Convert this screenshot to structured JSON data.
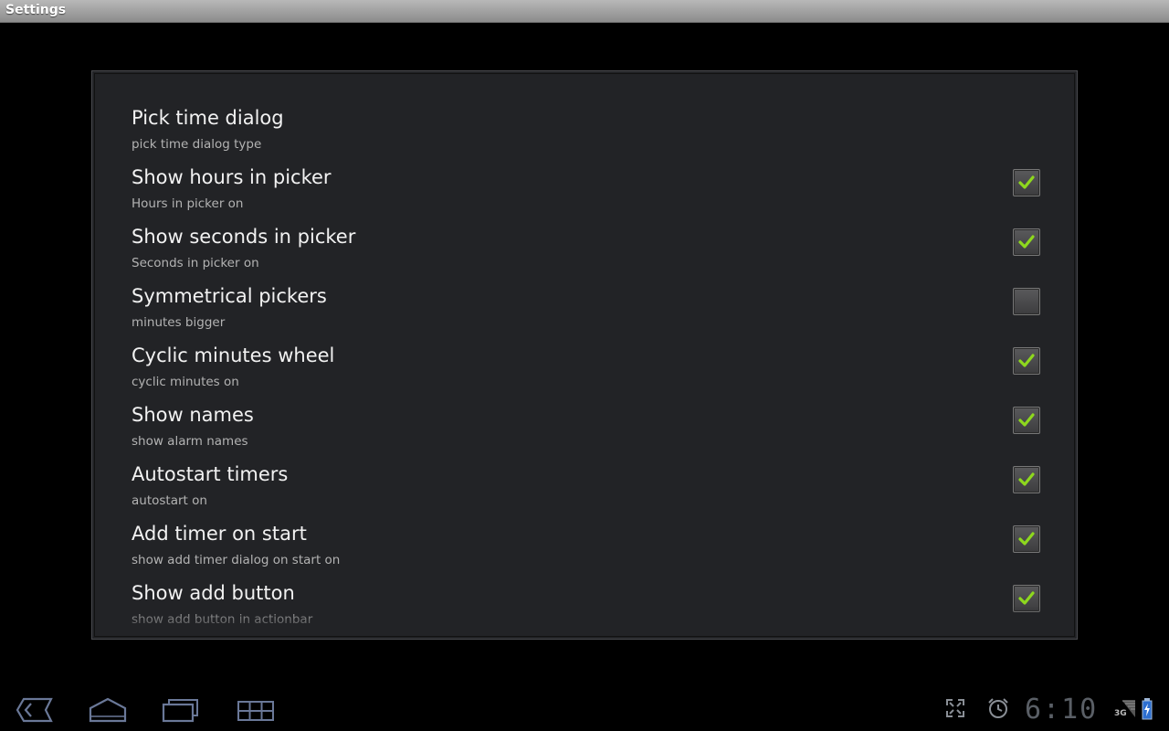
{
  "window": {
    "title": "Settings"
  },
  "preferences": [
    {
      "title": "Pick time dialog",
      "summary": "pick time dialog type",
      "has_checkbox": false,
      "checked": false
    },
    {
      "title": "Show hours in picker",
      "summary": "Hours in picker on",
      "has_checkbox": true,
      "checked": true
    },
    {
      "title": "Show seconds in picker",
      "summary": "Seconds in picker on",
      "has_checkbox": true,
      "checked": true
    },
    {
      "title": "Symmetrical pickers",
      "summary": "minutes bigger",
      "has_checkbox": true,
      "checked": false
    },
    {
      "title": "Cyclic minutes wheel",
      "summary": "cyclic minutes on",
      "has_checkbox": true,
      "checked": true
    },
    {
      "title": "Show names",
      "summary": "show alarm names",
      "has_checkbox": true,
      "checked": true
    },
    {
      "title": "Autostart timers",
      "summary": "autostart on",
      "has_checkbox": true,
      "checked": true
    },
    {
      "title": "Add timer on start",
      "summary": "show add timer dialog on start on",
      "has_checkbox": true,
      "checked": true
    },
    {
      "title": "Show add button",
      "summary": "show add button in actionbar",
      "has_checkbox": true,
      "checked": true
    }
  ],
  "statusbar": {
    "time": "6:10",
    "network": "3G",
    "icons": [
      "back-icon",
      "home-icon",
      "recent-apps-icon",
      "menu-grid-icon",
      "fullscreen-icon",
      "alarm-icon",
      "signal-icon",
      "battery-icon"
    ]
  },
  "colors": {
    "panel_bg": "#222326",
    "check_green": "#8ed81e",
    "nav_icon": "#5f6f8f",
    "clock": "#5a5f66"
  }
}
